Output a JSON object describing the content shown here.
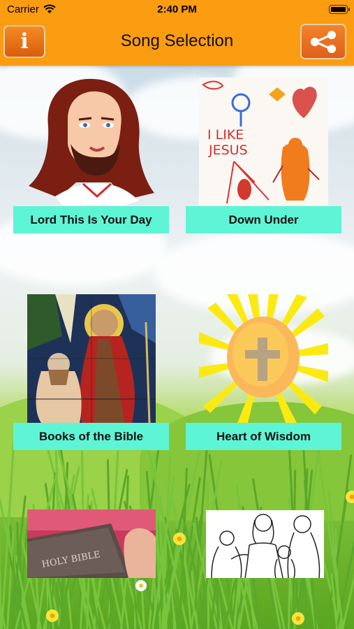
{
  "status": {
    "carrier": "Carrier",
    "time": "2:40 PM"
  },
  "nav": {
    "title": "Song Selection",
    "info_label": "i",
    "info_icon": "info-icon",
    "share_icon": "share-icon"
  },
  "songs": [
    {
      "label": "Lord This Is Your Day",
      "image": "jesus-portrait-illustration"
    },
    {
      "label": "Down Under",
      "image": "child-drawing-i-like-jesus"
    },
    {
      "label": "Books of the Bible",
      "image": "stained-glass-baptism"
    },
    {
      "label": "Heart of Wisdom",
      "image": "sun-with-cross"
    },
    {
      "label": "",
      "image": "holy-bible-book"
    },
    {
      "label": "",
      "image": "jesus-with-children-line-art"
    }
  ],
  "drawing_text": "I LIKE JESUS",
  "bible_text": "HOLY BIBLE",
  "colors": {
    "bar": "#fb9c11",
    "label_bg": "#5df5d6"
  }
}
